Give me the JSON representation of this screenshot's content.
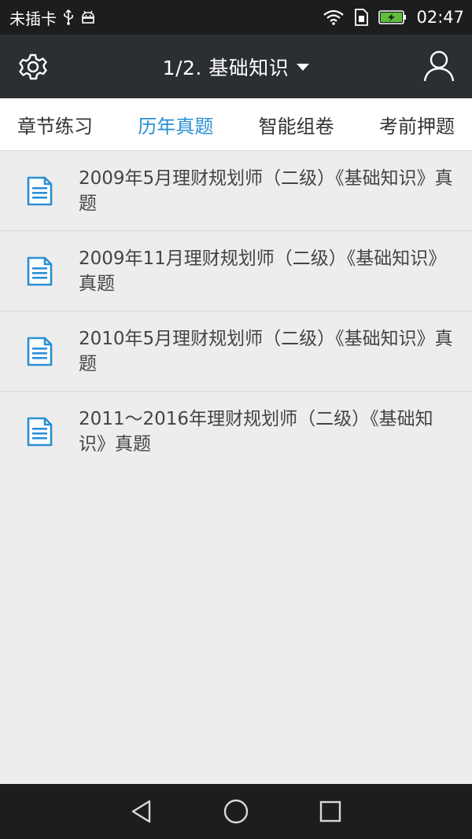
{
  "status_bar": {
    "carrier": "未插卡",
    "time": "02:47",
    "icons": [
      "usb-icon",
      "android-debug-icon",
      "wifi-icon",
      "sim-icon",
      "battery-charging-icon"
    ]
  },
  "app_bar": {
    "title": "1/2. 基础知识",
    "left_icon": "gear-icon",
    "right_icon": "user-icon"
  },
  "tabs": [
    {
      "label": "章节练习",
      "active": false
    },
    {
      "label": "历年真题",
      "active": true
    },
    {
      "label": "智能组卷",
      "active": false
    },
    {
      "label": "考前押题",
      "active": false
    }
  ],
  "list": {
    "items": [
      {
        "title": "2009年5月理财规划师（二级）《基础知识》真题"
      },
      {
        "title": "2009年11月理财规划师（二级）《基础知识》真题"
      },
      {
        "title": "2010年5月理财规划师（二级）《基础知识》真题"
      },
      {
        "title": "2011～2016年理财规划师（二级）《基础知识》真题"
      }
    ]
  },
  "colors": {
    "accent": "#2a8fd6",
    "app_bar": "#2b2e32",
    "status_bar": "#1b1d1f",
    "background": "#ededed"
  },
  "nav_bar": {
    "icons": [
      "back-icon",
      "home-icon",
      "recents-icon"
    ]
  }
}
